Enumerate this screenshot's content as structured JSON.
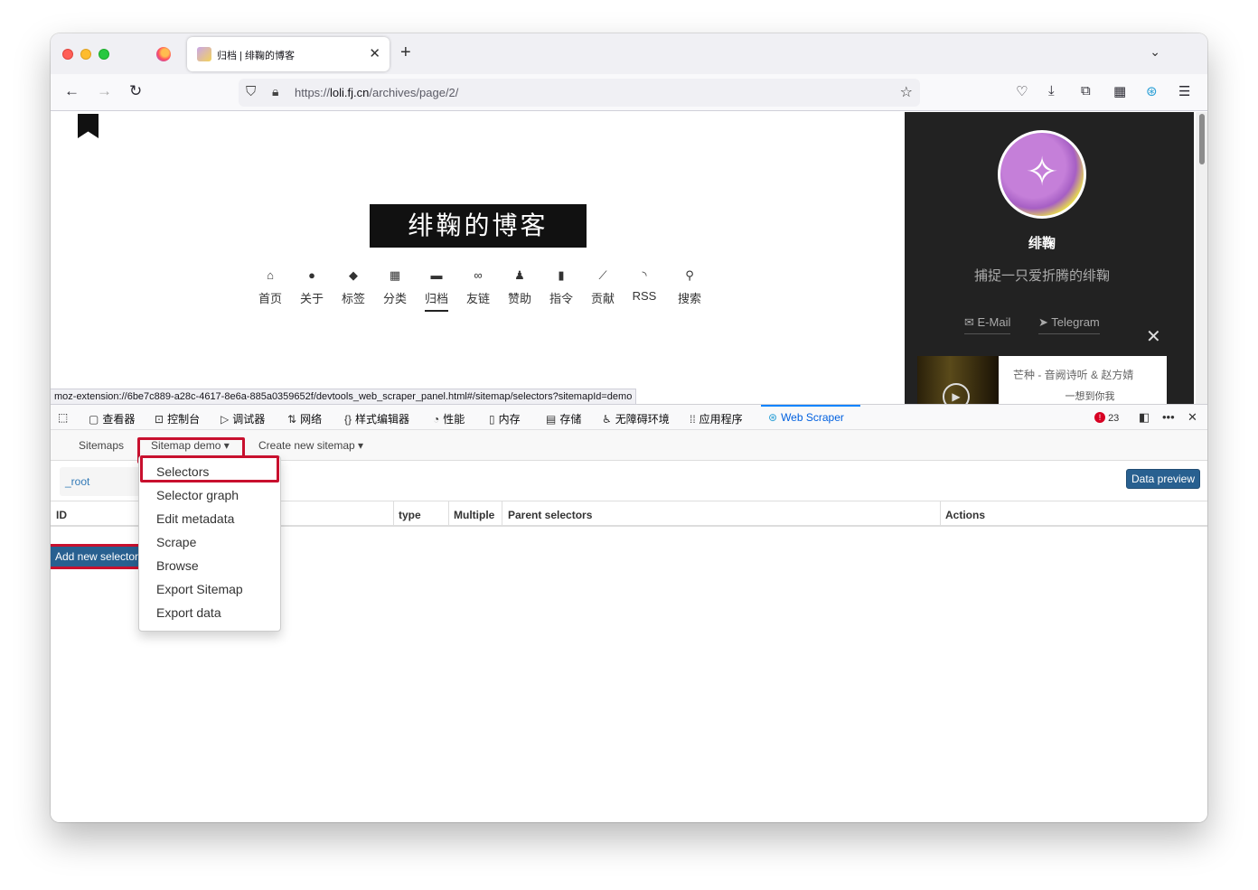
{
  "browser": {
    "tab_title": "归档 | 绯鞠的博客",
    "tab_close": "✕",
    "new_tab": "+",
    "tab_list": "⌄",
    "url_prefix": "https://",
    "url_host": "loli.fj.cn",
    "url_path": "/archives/page/2/",
    "status_url": "moz-extension://6be7c889-a28c-4617-8e6a-885a0359652f/devtools_web_scraper_panel.html#/sitemap/selectors?sitemapId=demo"
  },
  "page": {
    "logo_text": "绯鞠的博客",
    "menu": [
      {
        "label": "首页",
        "icon": "home-icon"
      },
      {
        "label": "关于",
        "icon": "user-icon"
      },
      {
        "label": "标签",
        "icon": "tags-icon"
      },
      {
        "label": "分类",
        "icon": "grid-icon"
      },
      {
        "label": "归档",
        "icon": "archive-icon"
      },
      {
        "label": "友链",
        "icon": "link-icon"
      },
      {
        "label": "赞助",
        "icon": "donate-icon"
      },
      {
        "label": "指令",
        "icon": "book-icon"
      },
      {
        "label": "贡献",
        "icon": "chart-icon"
      },
      {
        "label": "RSS",
        "icon": "rss-icon"
      },
      {
        "label": "搜索",
        "icon": "search-icon"
      }
    ],
    "active_menu": "归档",
    "sidebar": {
      "name": "绯鞠",
      "motto": "捕捉一只爱折腾的绯鞠",
      "email_label": "E-Mail",
      "telegram_label": "Telegram",
      "player_title": "芒种 - 音阙诗听 & 赵方婧",
      "player_lyric": "一想到你我"
    }
  },
  "devtools": {
    "tabs": [
      {
        "label": "查看器",
        "icon": "inspector-icon"
      },
      {
        "label": "控制台",
        "icon": "console-icon"
      },
      {
        "label": "调试器",
        "icon": "debugger-icon"
      },
      {
        "label": "网络",
        "icon": "network-icon"
      },
      {
        "label": "样式编辑器",
        "icon": "style-editor-icon"
      },
      {
        "label": "性能",
        "icon": "performance-icon"
      },
      {
        "label": "内存",
        "icon": "memory-icon"
      },
      {
        "label": "存储",
        "icon": "storage-icon"
      },
      {
        "label": "无障碍环境",
        "icon": "accessibility-icon"
      },
      {
        "label": "应用程序",
        "icon": "application-icon"
      },
      {
        "label": "Web Scraper",
        "icon": "web-scraper-icon"
      }
    ],
    "active_tab": "Web Scraper",
    "error_count": "23"
  },
  "scraper": {
    "nav": {
      "sitemaps": "Sitemaps",
      "sitemap_demo": "Sitemap demo ▾",
      "create_new": "Create new sitemap ▾"
    },
    "breadcrumb_root": "_root",
    "data_preview": "Data preview",
    "columns": [
      "ID",
      "type",
      "Multiple",
      "Parent selectors",
      "Actions"
    ],
    "add_new_selector": "Add new selector",
    "dropdown": [
      "Selectors",
      "Selector graph",
      "Edit metadata",
      "Scrape",
      "Browse",
      "Export Sitemap",
      "Export data"
    ]
  },
  "colors": {
    "highlight": "#c8102e",
    "primary_button": "#286090",
    "link": "#337ab7",
    "sidebar_bg": "#222222"
  }
}
